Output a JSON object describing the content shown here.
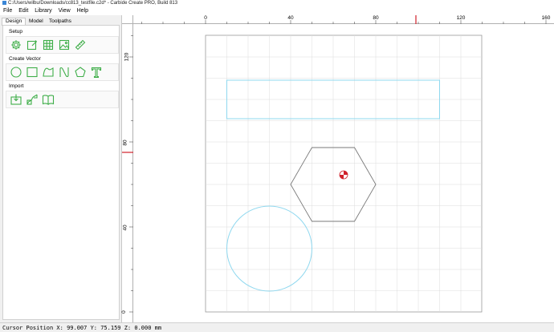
{
  "window": {
    "title": "C:/Users/wilbu/Downloads/cc813_testfile.c2d* - Carbide Create PRO, Build 813"
  },
  "menu": {
    "file": "File",
    "edit": "Edit",
    "library": "Library",
    "view": "View",
    "help": "Help"
  },
  "tabs": [
    {
      "label": "Design"
    },
    {
      "label": "Model"
    },
    {
      "label": "Toolpaths"
    }
  ],
  "panel": {
    "setup": {
      "title": "Setup"
    },
    "create_vector": {
      "title": "Create Vector"
    },
    "import": {
      "title": "Import"
    }
  },
  "ruler": {
    "x_labels": [
      "0",
      "40",
      "80",
      "120",
      "160"
    ],
    "y_labels": [
      "120",
      "80",
      "40",
      "0"
    ]
  },
  "colors": {
    "icon_green": "#3fae49",
    "selection_cyan": "#8fd8ef",
    "marker_red": "#d0202a"
  },
  "icons": {
    "setup": [
      "gear-icon",
      "edit-icon",
      "grid-icon",
      "image-icon",
      "ruler-icon"
    ],
    "create_vector": [
      "circle-icon",
      "rectangle-icon",
      "curve-icon",
      "polygon-icon",
      "text-icon"
    ],
    "import": [
      "import-icon",
      "import-vector-icon",
      "library-icon"
    ]
  },
  "status": {
    "text": "Cursor Position X: 99.007 Y: 75.159 Z: 0.000 mm"
  }
}
